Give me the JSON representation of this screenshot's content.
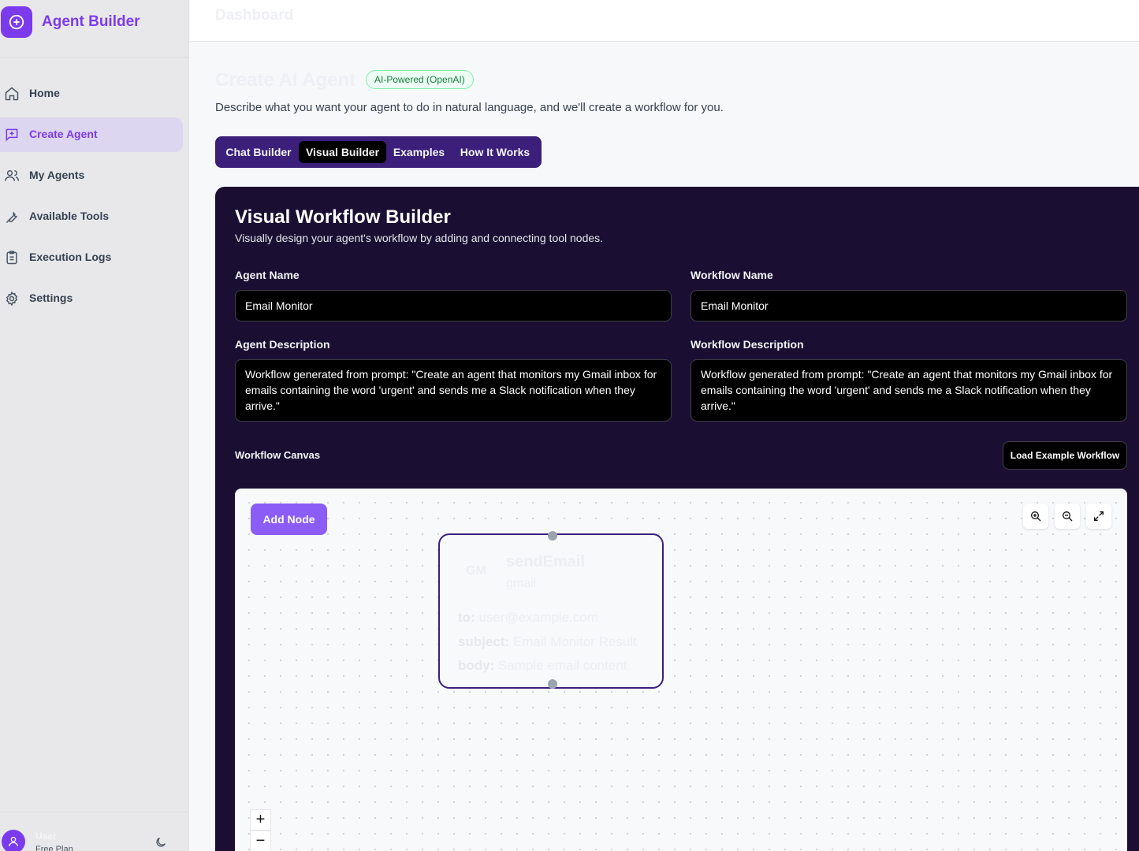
{
  "app": {
    "title": "Agent Builder"
  },
  "sidebar": {
    "items": [
      {
        "label": "Home",
        "icon": "home-icon"
      },
      {
        "label": "Create Agent",
        "icon": "message-plus-icon",
        "active": true
      },
      {
        "label": "My Agents",
        "icon": "users-icon"
      },
      {
        "label": "Available Tools",
        "icon": "wrench-icon"
      },
      {
        "label": "Execution Logs",
        "icon": "clipboard-icon"
      },
      {
        "label": "Settings",
        "icon": "gear-icon"
      }
    ],
    "user": {
      "name": "User",
      "plan": "Free Plan"
    }
  },
  "header": {
    "title": "Dashboard"
  },
  "main": {
    "title": "Create AI Agent",
    "badge": "AI-Powered (OpenAI)",
    "description": "Describe what you want your agent to do in natural language, and we'll create a workflow for you.",
    "tabs": [
      {
        "label": "Chat Builder"
      },
      {
        "label": "Visual Builder",
        "active": true
      },
      {
        "label": "Examples"
      },
      {
        "label": "How It Works"
      }
    ]
  },
  "builder": {
    "title": "Visual Workflow Builder",
    "subtitle": "Visually design your agent's workflow by adding and connecting tool nodes.",
    "agent_name_label": "Agent Name",
    "agent_name_value": "Email Monitor",
    "workflow_name_label": "Workflow Name",
    "workflow_name_value": "Email Monitor",
    "agent_desc_label": "Agent Description",
    "agent_desc_value": "Workflow generated from prompt: \"Create an agent that monitors my Gmail inbox for emails containing the word 'urgent' and sends me a Slack notification when they arrive.\"",
    "workflow_desc_label": "Workflow Description",
    "workflow_desc_value": "Workflow generated from prompt: \"Create an agent that monitors my Gmail inbox for emails containing the word 'urgent' and sends me a Slack notification when they arrive.\"",
    "canvas_label": "Workflow Canvas",
    "load_example_label": "Load Example Workflow"
  },
  "canvas": {
    "add_node_label": "Add Node",
    "zoom_controls": [
      "zoom-in-icon",
      "zoom-out-icon",
      "expand-icon"
    ],
    "node": {
      "badge": "GM",
      "title": "sendEmail",
      "subtitle": "gmail",
      "params": [
        {
          "key": "to:",
          "value": "user@example.com"
        },
        {
          "key": "subject:",
          "value": "Email Monitor Result"
        },
        {
          "key": "body:",
          "value": "Sample email content"
        }
      ]
    },
    "controls": {
      "plus": "+",
      "minus": "−"
    }
  },
  "colors": {
    "accent": "#7c3aed",
    "panel_bg": "#1a0f33",
    "tabs_bg": "#3b1f7a",
    "badge_green": "#15803d"
  }
}
